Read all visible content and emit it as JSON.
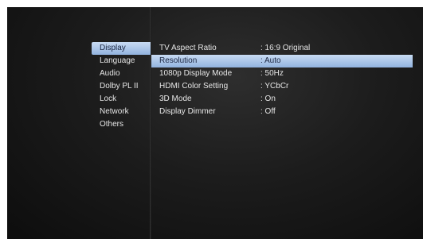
{
  "menu": {
    "items": [
      {
        "label": "Display"
      },
      {
        "label": "Language"
      },
      {
        "label": "Audio"
      },
      {
        "label": "Dolby PL II"
      },
      {
        "label": "Lock"
      },
      {
        "label": "Network"
      },
      {
        "label": "Others"
      }
    ],
    "selected_index": 0
  },
  "settings": {
    "rows": [
      {
        "name": "TV Aspect Ratio",
        "value": ": 16:9 Original"
      },
      {
        "name": "Resolution",
        "value": ": Auto"
      },
      {
        "name": "1080p Display Mode",
        "value": ": 50Hz"
      },
      {
        "name": "HDMI Color Setting",
        "value": ": YCbCr"
      },
      {
        "name": "3D Mode",
        "value": ": On"
      },
      {
        "name": "Display Dimmer",
        "value": ": Off"
      }
    ],
    "highlighted_index": 1
  },
  "colors": {
    "highlight_top": "#c8dbf3",
    "highlight_bottom": "#92b3df",
    "background": "#1c1c1c",
    "text": "#e6e6e6"
  }
}
